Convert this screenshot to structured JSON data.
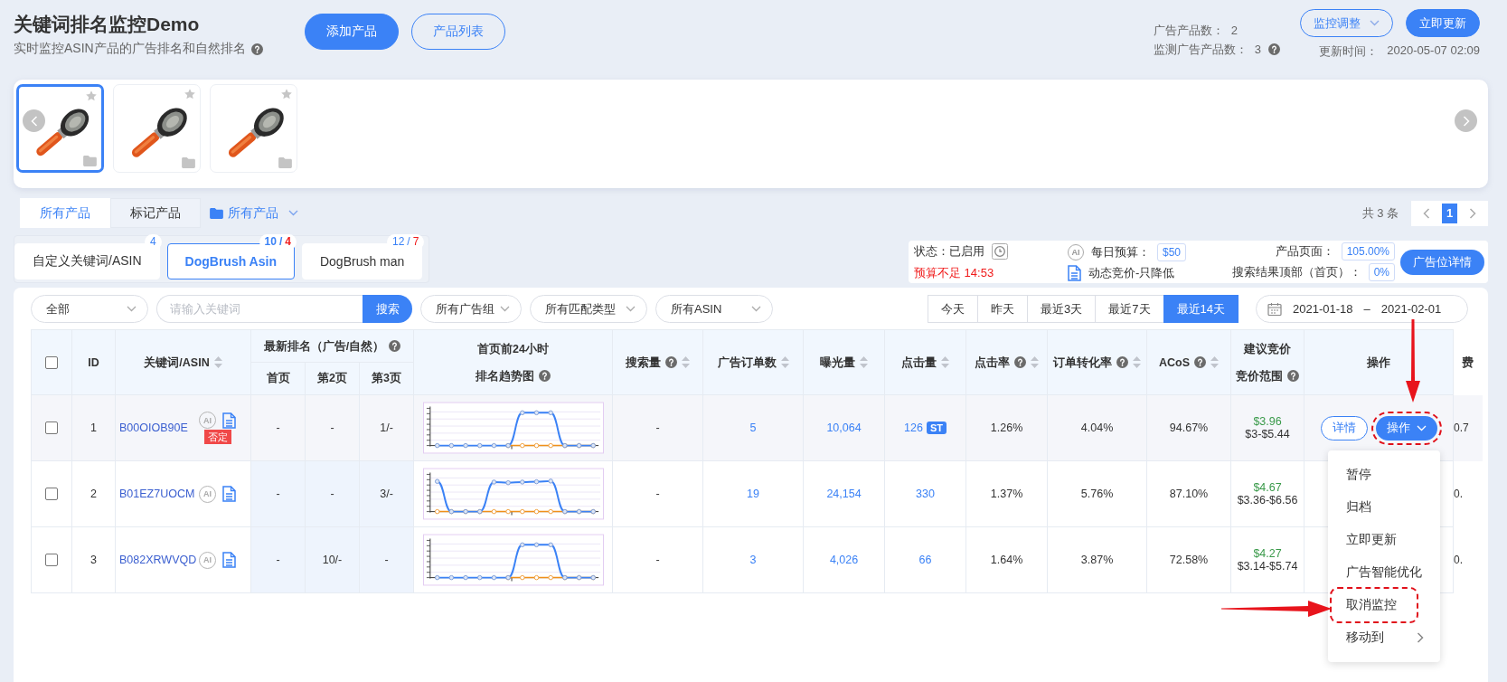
{
  "header": {
    "title": "关键词排名监控Demo",
    "subtitle": "实时监控ASIN产品的广告排名和自然排名",
    "subtitle_help": true,
    "buttons": [
      {
        "label": "添加产品",
        "kind": "primary"
      },
      {
        "label": "产品列表",
        "kind": "outline"
      }
    ],
    "stats": [
      {
        "label": "广告产品数：",
        "value": "2",
        "help": false
      },
      {
        "label": "监测广告产品数：",
        "value": "3",
        "help": true
      }
    ],
    "monitor_button": "监控调整",
    "update_button": "立即更新",
    "update_time_label": "更新时间：",
    "update_time": "2020-05-07 02:09"
  },
  "products": [
    {
      "kind": "picture",
      "selected": true
    },
    {
      "kind": "picture",
      "selected": false
    },
    {
      "kind": "picture",
      "selected": false
    }
  ],
  "product_tabs": [
    {
      "label": "所有产品",
      "selected": true
    },
    {
      "label": "标记产品",
      "selected": false
    }
  ],
  "folder_filter": "所有产品",
  "pagination": {
    "total": "共 3 条",
    "pages": [
      {
        "label": "1",
        "selected": true
      }
    ]
  },
  "keyword_groups": [
    {
      "label": "自定义关键词/ASIN",
      "selected": false,
      "badge": [
        {
          "text": "4",
          "kind": "total"
        }
      ]
    },
    {
      "label": "DogBrush Asin",
      "selected": true,
      "badge": [
        {
          "text": "10",
          "kind": "total"
        },
        {
          "text": "/",
          "kind": "separator"
        },
        {
          "text": "4",
          "kind": "alert"
        }
      ]
    },
    {
      "label": "DogBrush man",
      "selected": false,
      "badge": [
        {
          "text": "12",
          "kind": "total"
        },
        {
          "text": "/",
          "kind": "separator"
        },
        {
          "text": "7",
          "kind": "alert"
        }
      ]
    }
  ],
  "campaign": {
    "status": "状态：已启用",
    "budget_warning": "预算不足 14:53",
    "ai_label": "AI",
    "budget_label": "每日预算：",
    "budget": "$50",
    "bidding": "动态竞价-只降低",
    "placements": [
      {
        "label": "产品页面：",
        "value": "105.00%"
      },
      {
        "label": "搜索结果顶部（首页）：",
        "value": "0%"
      }
    ],
    "details_button": "广告位详情"
  },
  "filters": {
    "scope": "全部",
    "search_placeholder": "请输入关键词",
    "search_button": "搜索",
    "selects": [
      "所有广告组",
      "所有匹配类型",
      "所有ASIN"
    ]
  },
  "date_ranges": [
    {
      "label": "今天",
      "selected": false
    },
    {
      "label": "昨天",
      "selected": false
    },
    {
      "label": "最近3天",
      "selected": false
    },
    {
      "label": "最近7天",
      "selected": false
    },
    {
      "label": "最近14天",
      "selected": true
    }
  ],
  "date_picker": {
    "start": "2021-01-18",
    "separator": "–",
    "end": "2021-02-01"
  },
  "table": {
    "columns": [
      {
        "kind": "checkbox",
        "checked": false
      },
      {
        "kind": "text",
        "lines": [
          "ID"
        ],
        "sortable": false,
        "help": false
      },
      {
        "kind": "text",
        "lines": [
          "关键词/ASIN"
        ],
        "sortable": true,
        "help": false
      },
      {
        "kind": "group",
        "lines": [
          "最新排名（广告/自然）"
        ],
        "help": true,
        "children": [
          "首页",
          "第2页",
          "第3页"
        ]
      },
      {
        "kind": "text",
        "lines": [
          "首页前24小时",
          "排名趋势图"
        ],
        "sortable": false,
        "help": true
      },
      {
        "kind": "text",
        "lines": [
          "搜索量"
        ],
        "sortable": true,
        "help": true
      },
      {
        "kind": "text",
        "lines": [
          "广告订单数"
        ],
        "sortable": true,
        "help": false
      },
      {
        "kind": "text",
        "lines": [
          "曝光量"
        ],
        "sortable": true,
        "help": false
      },
      {
        "kind": "text",
        "lines": [
          "点击量"
        ],
        "sortable": true,
        "help": false
      },
      {
        "kind": "text",
        "lines": [
          "点击率"
        ],
        "sortable": true,
        "help": true
      },
      {
        "kind": "text",
        "lines": [
          "订单转化率"
        ],
        "sortable": true,
        "help": true
      },
      {
        "kind": "text",
        "lines": [
          "ACoS"
        ],
        "sortable": true,
        "help": true
      },
      {
        "kind": "text",
        "lines": [
          "建议竞价",
          "竞价范围"
        ],
        "sortable": false,
        "help": true
      },
      {
        "kind": "text",
        "lines": [
          "操作"
        ],
        "sortable": false,
        "help": false
      },
      {
        "kind": "text",
        "lines": [
          "费"
        ],
        "sortable": false,
        "help": false
      }
    ],
    "rows": [
      {
        "checked": false,
        "hovered": true,
        "rank_highlight": false,
        "id": "1",
        "keyword": "B00OIOB90E",
        "ai_label": "AI",
        "tag": "否定",
        "ranks": [
          "-",
          "-",
          "1/-"
        ],
        "search_volume": "-",
        "orders": "5",
        "impressions": "10,064",
        "clicks": "126",
        "clicks_tag": "ST",
        "ctr": "1.26%",
        "cvr": "4.04%",
        "acos": "94.67%",
        "bid": "$3.96",
        "bid_range": "$3-$5.44",
        "detail_button": "详情",
        "action_button": "操作",
        "action_annotated": true,
        "fee": "0.7"
      },
      {
        "checked": false,
        "hovered": false,
        "rank_highlight": true,
        "id": "2",
        "keyword": "B01EZ7UOCM",
        "ai_label": "AI",
        "ranks": [
          "-",
          "-",
          "3/-"
        ],
        "search_volume": "-",
        "orders": "19",
        "impressions": "24,154",
        "clicks": "330",
        "ctr": "1.37%",
        "cvr": "5.76%",
        "acos": "87.10%",
        "bid": "$4.67",
        "bid_range": "$3.36-$6.56",
        "fee": "0."
      },
      {
        "checked": false,
        "hovered": false,
        "rank_highlight": true,
        "id": "3",
        "keyword": "B082XRWVQD",
        "ai_label": "AI",
        "ranks": [
          "-",
          "10/-",
          "-"
        ],
        "search_volume": "-",
        "orders": "3",
        "impressions": "4,026",
        "clicks": "66",
        "ctr": "1.64%",
        "cvr": "3.87%",
        "acos": "72.58%",
        "bid": "$4.27",
        "bid_range": "$3.14-$5.74",
        "fee": "0."
      }
    ],
    "action_menu": [
      {
        "label": "暂停",
        "annotated": false,
        "submenu": false
      },
      {
        "label": "归档",
        "annotated": false,
        "submenu": false
      },
      {
        "label": "立即更新",
        "annotated": false,
        "submenu": false
      },
      {
        "label": "广告智能优化",
        "annotated": false,
        "submenu": false
      },
      {
        "label": "取消监控",
        "annotated": true,
        "submenu": false
      },
      {
        "label": "移动到",
        "annotated": false,
        "submenu": true
      }
    ]
  },
  "annotations": [
    {
      "kind": "arrow-down"
    },
    {
      "kind": "arrow-right"
    }
  ]
}
